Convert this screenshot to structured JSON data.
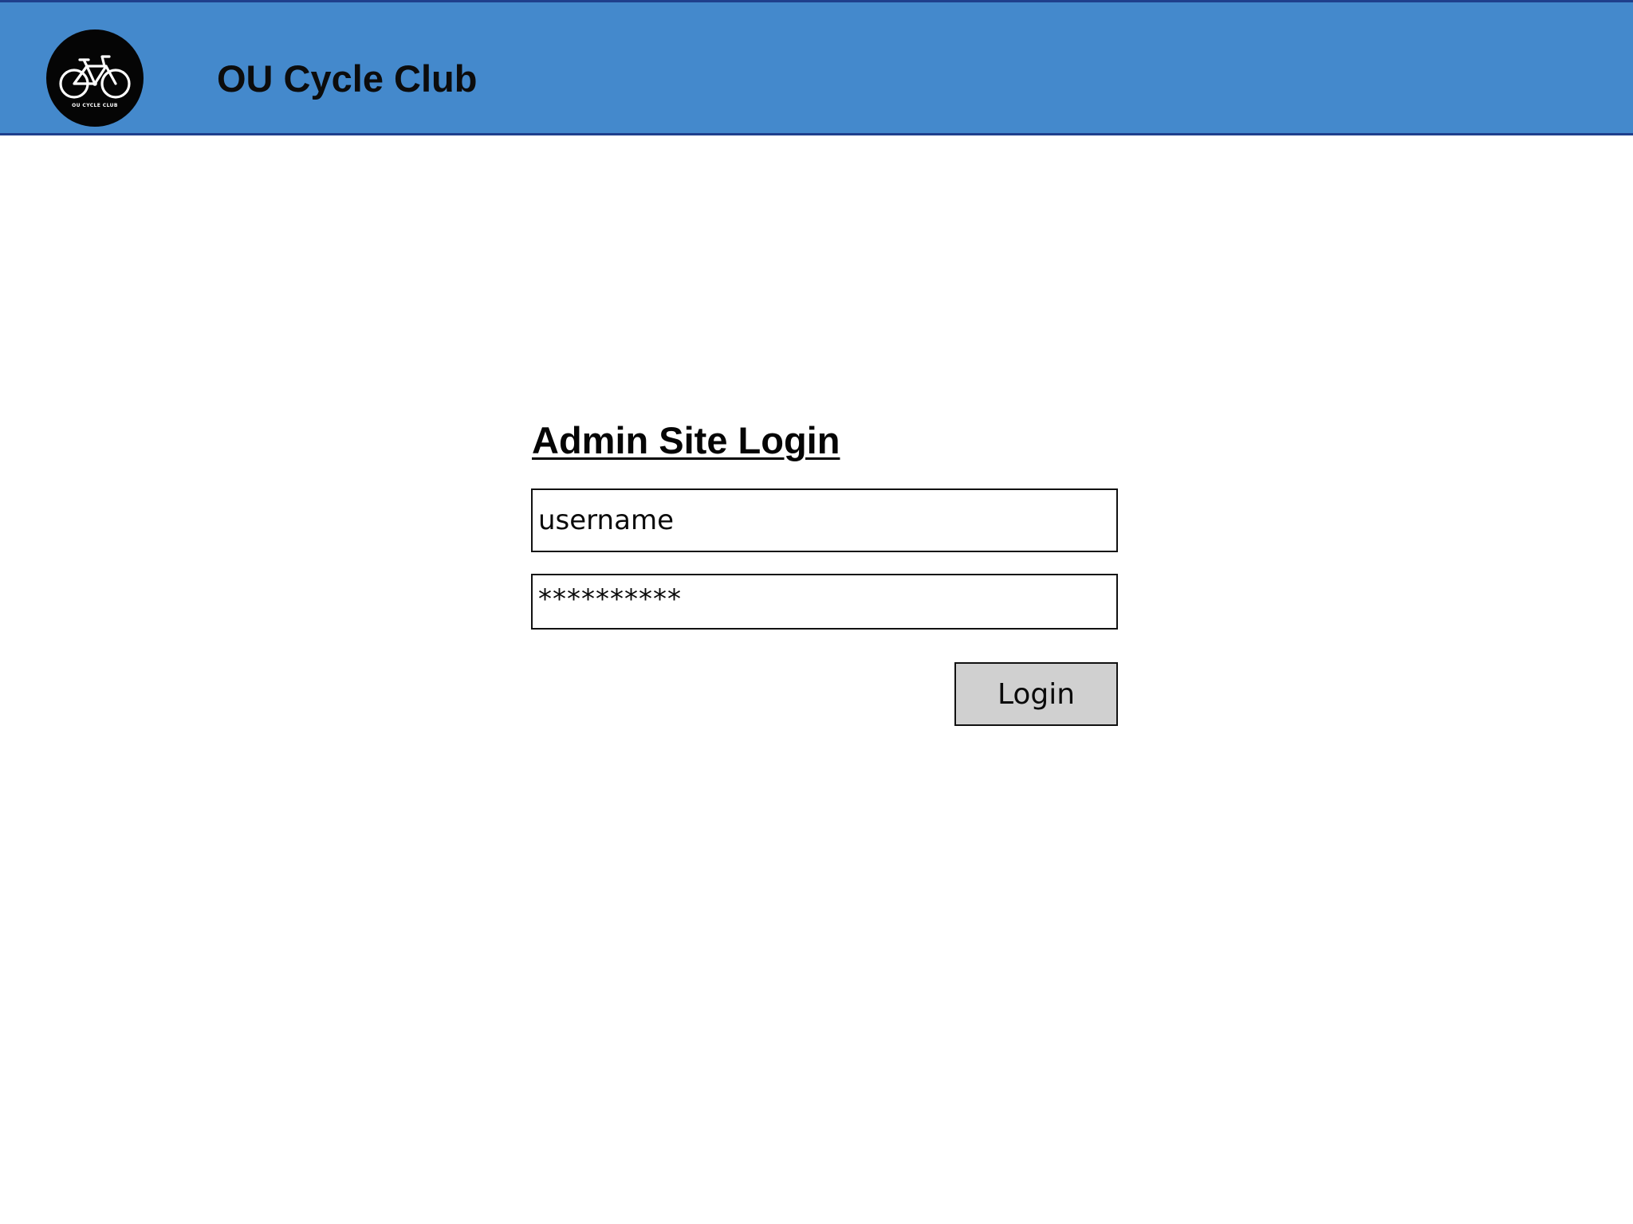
{
  "header": {
    "title": "OU Cycle Club",
    "logo": {
      "icon": "bicycle-icon",
      "text": "OU CYCLE CLUB"
    },
    "background_color": "#4489cc"
  },
  "login": {
    "heading": "Admin Site Login",
    "username_value": "username",
    "password_value": "**********",
    "button_label": "Login"
  }
}
